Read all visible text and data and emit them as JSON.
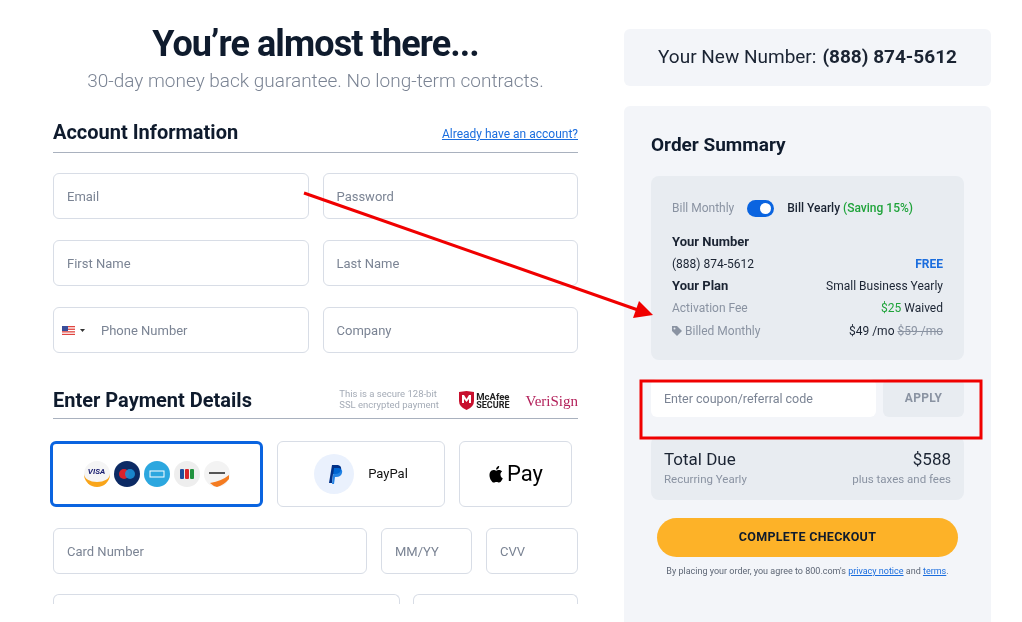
{
  "heading": "You’re almost there...",
  "subheading": "30-day money back guarantee. No long-term contracts.",
  "account": {
    "title": "Account Information",
    "link": "Already have an account?",
    "fields": [
      {
        "kind": "text",
        "placeholder": "Email"
      },
      {
        "kind": "text",
        "placeholder": "Password"
      },
      {
        "kind": "text",
        "placeholder": "First Name"
      },
      {
        "kind": "text",
        "placeholder": "Last Name"
      },
      {
        "kind": "phone",
        "placeholder": "Phone Number"
      },
      {
        "kind": "text",
        "placeholder": "Company"
      }
    ]
  },
  "payment": {
    "title": "Enter Payment Details",
    "secure_note": "This is a secure 128-bit SSL encrypted payment",
    "badges": [
      {
        "kind": "mcafee",
        "line1": "McAfee",
        "line2": "SECURE"
      },
      {
        "kind": "verisign",
        "line1": "VeriSign"
      }
    ],
    "methods": [
      {
        "kind": "cards",
        "label": "VISA",
        "selected": true
      },
      {
        "kind": "paypal",
        "label": "PayPal",
        "selected": false
      },
      {
        "kind": "applepay",
        "label": "Pay",
        "selected": false
      }
    ],
    "card_fields": [
      {
        "placeholder": "Card Number"
      },
      {
        "placeholder": "MM/YY"
      },
      {
        "placeholder": "CVV"
      }
    ]
  },
  "number_banner": {
    "label": "Your New Number:",
    "number": "(888) 874-5612"
  },
  "summary": {
    "title": "Order Summary",
    "billing": {
      "monthly": "Bill Monthly",
      "yearly": "Bill Yearly",
      "saving": "(Saving 15%)",
      "on": true
    },
    "rows": [
      {
        "kind": "heading",
        "left": "Your Number"
      },
      {
        "kind": "value",
        "left": "(888) 874-5612",
        "right": "FREE"
      },
      {
        "kind": "plan",
        "left": "Your Plan",
        "right": "Small Business Yearly"
      },
      {
        "kind": "fee",
        "left": "Activation Fee",
        "old": "$25",
        "right": "Waived"
      },
      {
        "kind": "billed",
        "left": "Billed Monthly",
        "right": "$49 /mo",
        "old": "$59 /mo"
      }
    ],
    "coupon": {
      "placeholder": "Enter coupon/referral code",
      "button": "APPLY"
    },
    "total": {
      "label": "Total Due",
      "amount": "$588",
      "note_left": "Recurring Yearly",
      "note_right": "plus taxes and fees"
    },
    "checkout": "COMPLETE CHECKOUT",
    "legal": {
      "text": "By placing your order, you agree to 800.com's",
      "link1": "privacy notice",
      "and": "and",
      "link2": "terms",
      "end": "."
    }
  }
}
